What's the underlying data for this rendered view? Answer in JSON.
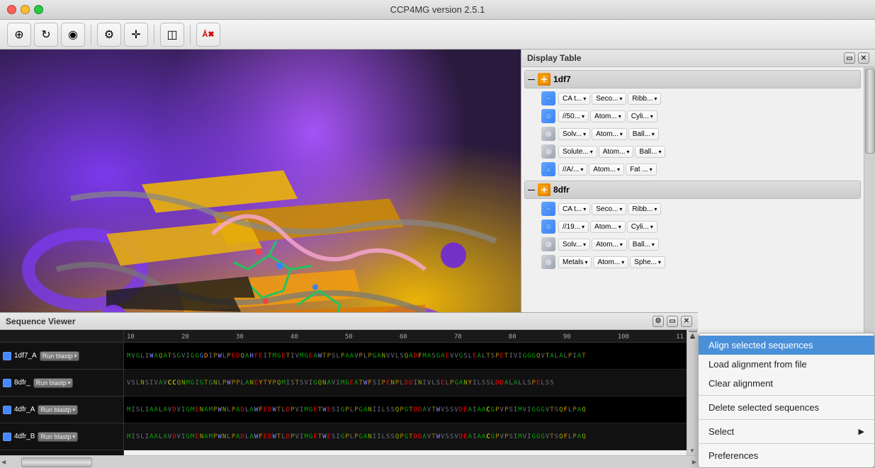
{
  "app": {
    "title": "CCP4MG version 2.5.1"
  },
  "titlebar": {
    "buttons": [
      "close",
      "minimize",
      "maximize"
    ]
  },
  "toolbar": {
    "buttons": [
      {
        "name": "crystal-icon",
        "symbol": "⊕"
      },
      {
        "name": "rotation-icon",
        "symbol": "↻"
      },
      {
        "name": "color-icon",
        "symbol": "◉"
      },
      {
        "name": "settings-icon",
        "symbol": "⚙"
      },
      {
        "name": "crosshair-icon",
        "symbol": "✛"
      },
      {
        "name": "view-icon",
        "symbol": "◫"
      },
      {
        "name": "script-icon",
        "symbol": "Å"
      }
    ]
  },
  "display_table": {
    "title": "Display Table",
    "groups": [
      {
        "name": "1df7",
        "expanded": true,
        "rows": [
          {
            "icon_color": "#3b82f6",
            "cells": [
              "CA t...",
              "Seco...",
              "Ribb..."
            ]
          },
          {
            "icon_color": "#3b82f6",
            "cells": [
              "//50...",
              "Atom...",
              "Cyli..."
            ]
          },
          {
            "icon_color": "#6b7280",
            "cells": [
              "Solv...",
              "Atom...",
              "Ball..."
            ]
          },
          {
            "icon_color": "#6b7280",
            "cells": [
              "Solute...",
              "Atom...",
              "Ball..."
            ]
          },
          {
            "icon_color": "#3b82f6",
            "cells": [
              "//A/...",
              "Atom...",
              "Fat ..."
            ]
          }
        ]
      },
      {
        "name": "8dfr",
        "expanded": true,
        "rows": [
          {
            "icon_color": "#3b82f6",
            "cells": [
              "CA t...",
              "Seco...",
              "Ribb..."
            ]
          },
          {
            "icon_color": "#3b82f6",
            "cells": [
              "//19...",
              "Atom...",
              "Cyli..."
            ]
          },
          {
            "icon_color": "#6b7280",
            "cells": [
              "Solv...",
              "Atom...",
              "Ball..."
            ]
          },
          {
            "icon_color": "#6b7280",
            "cells": [
              "Metals",
              "Atom...",
              "Sphe..."
            ]
          }
        ]
      }
    ]
  },
  "sequence_viewer": {
    "title": "Sequence Viewer",
    "ruler_marks": [
      "10",
      "20",
      "30",
      "40",
      "50",
      "60",
      "70",
      "80",
      "90",
      "100",
      "11"
    ],
    "rows": [
      {
        "label": "1df7_A",
        "checked": true,
        "run_btn": "Run blastp",
        "sequence": "MVGLIWAQATSGVIGGGDIPWLPEDQAHFEITMGETIVMGEAWTPSLPAAVPLPGANVVLSQADFMASGAEVVGSLEALTSPETIVIGGGQVTALALPIAT"
      },
      {
        "label": "8dfr_",
        "checked": true,
        "run_btn": "Run blastp",
        "sequence": "VSLNSIVAVCCQNMGIGTGNLPWPPLANEYTYPQMISTSVIGQNAVIMGEATWFSIPENPLDDINIVLSELPGANYILSSLDDALALLSPELSS"
      },
      {
        "label": "4dfr_A",
        "checked": true,
        "run_btn": "Run blastp",
        "sequence": "MISLIAALAVDVIGMENAMPWNLPADLAWFEDWTLDPVIMGETWESIGPLPGANIILSSQPGTDDAVTWVSSVDEAIAACGPVPSIMVIGGGVTSQFLPAQ"
      },
      {
        "label": "4dfr_B",
        "checked": true,
        "run_btn": "Run blastp",
        "sequence": "MISLIAALAVDVIGMENAMPWNLPADLAWFEDWTLDPVIMGETWESIGPLPGANIILSSQPGTDDAVTWVSSVDEAIAACGPVPSIMVIGGGVTSQFLPAQ"
      }
    ]
  },
  "context_menu": {
    "items": [
      {
        "label": "Align selected sequences",
        "active": true,
        "arrow": false
      },
      {
        "label": "Load alignment from file",
        "active": false,
        "arrow": false
      },
      {
        "label": "Clear alignment",
        "active": false,
        "arrow": false
      },
      {
        "separator": true
      },
      {
        "label": "Delete selected sequences",
        "active": false,
        "arrow": false
      },
      {
        "separator": true
      },
      {
        "label": "Select",
        "active": false,
        "arrow": true
      },
      {
        "separator": true
      },
      {
        "label": "Preferences",
        "active": false,
        "arrow": false
      }
    ]
  }
}
